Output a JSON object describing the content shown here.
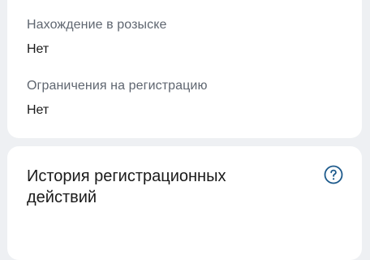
{
  "info_card": {
    "wanted": {
      "label": "Нахождение в розыске",
      "value": "Нет"
    },
    "restrictions": {
      "label": "Ограничения на регистрацию",
      "value": "Нет"
    }
  },
  "history_card": {
    "title": "История регистрационных действий",
    "help_icon": "question-circle-icon",
    "accent_color": "#1d5a8c"
  }
}
